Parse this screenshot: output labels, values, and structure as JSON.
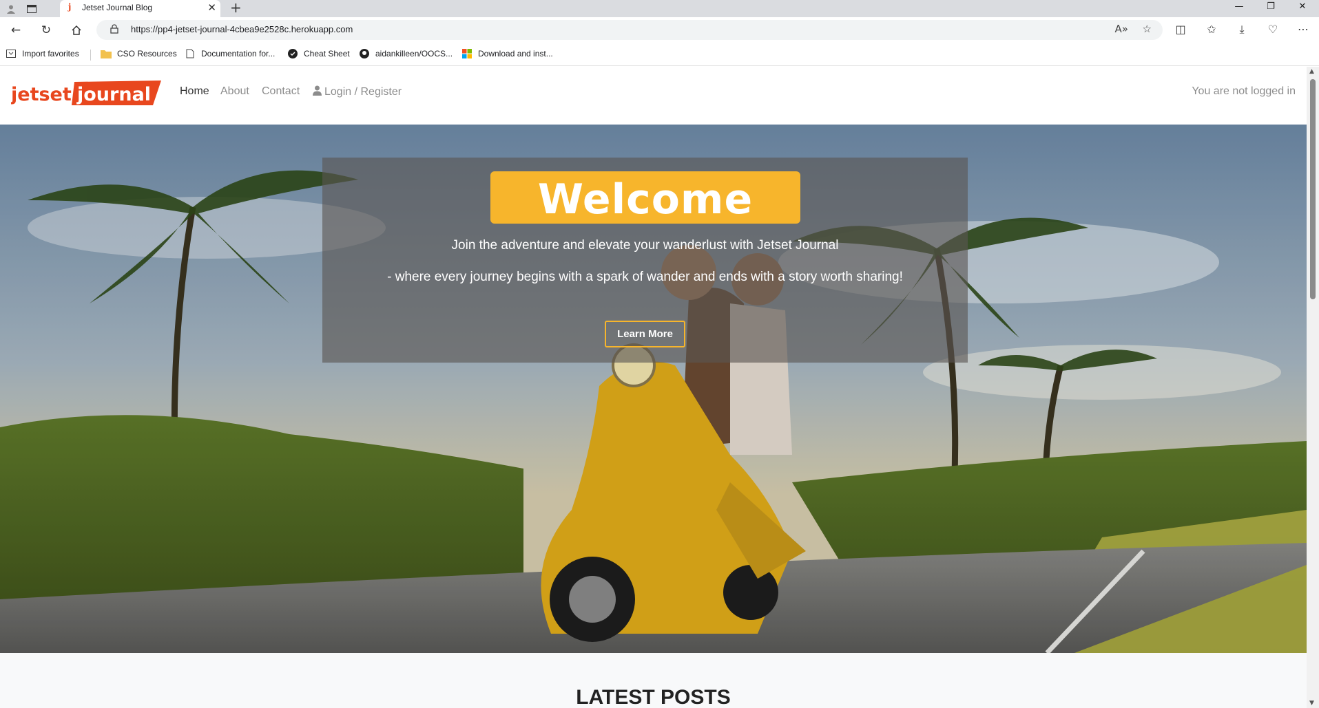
{
  "browser": {
    "tab_title": "Jetset Journal Blog",
    "url": "https://pp4-jetset-journal-4cbea9e2528c.herokuapp.com",
    "bookmarks": [
      {
        "label": "Import favorites",
        "icon": "import-icon"
      },
      {
        "label": "CSO Resources",
        "icon": "folder-icon"
      },
      {
        "label": "Documentation for...",
        "icon": "page-icon"
      },
      {
        "label": "Cheat Sheet",
        "icon": "cheat-sheet-icon"
      },
      {
        "label": "aidankilleen/OOCS...",
        "icon": "github-icon"
      },
      {
        "label": "Download and inst...",
        "icon": "windows-icon"
      }
    ]
  },
  "site": {
    "logo_text": "jetset journal",
    "nav": {
      "home": "Home",
      "about": "About",
      "contact": "Contact",
      "login": "Login / Register"
    },
    "login_status": "You are not logged in"
  },
  "hero": {
    "welcome": "Welcome",
    "line1": "Join the adventure and elevate your wanderlust with Jetset Journal",
    "line2": "- where every journey begins with a spark of wander and ends with a story worth sharing!",
    "button": "Learn More"
  },
  "sections": {
    "latest_posts": "LATEST POSTS"
  },
  "colors": {
    "accent": "#f7b52c",
    "logo_red": "#e8471e"
  }
}
